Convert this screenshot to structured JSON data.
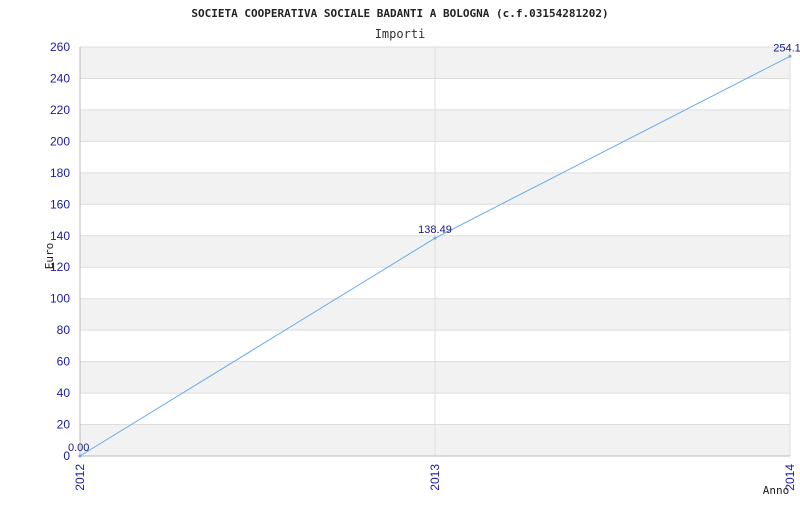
{
  "chart_data": {
    "type": "line",
    "title": "SOCIETA COOPERATIVA SOCIALE BADANTI A BOLOGNA (c.f.03154281202)",
    "subtitle": "Importi",
    "xlabel": "Anno",
    "ylabel": "Euro",
    "categories": [
      "2012",
      "2013",
      "2014"
    ],
    "series": [
      {
        "values": [
          0.0,
          138.49,
          254.1
        ],
        "data_labels": [
          "0.00",
          "138.49",
          "254.1"
        ]
      }
    ],
    "ylim": [
      0,
      260
    ],
    "y_ticks": [
      "0",
      "20",
      "40",
      "60",
      "80",
      "100",
      "120",
      "140",
      "160",
      "180",
      "200",
      "220",
      "240",
      "260"
    ],
    "grid": true,
    "colors": {
      "line": "#66aaee",
      "band": "#f2f2f2",
      "grid": "#dddddd",
      "tick_text": "#1a1aa6",
      "label_text": "#1a1a80"
    }
  }
}
